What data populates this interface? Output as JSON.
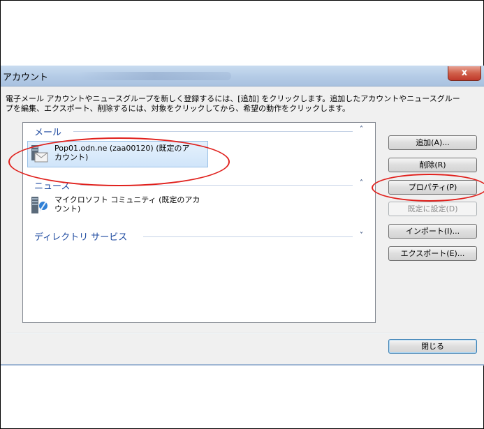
{
  "window": {
    "title": "アカウント",
    "close_label": "x"
  },
  "instruction": "電子メール アカウントやニュースグループを新しく登録するには、[追加] をクリックします。追加したアカウントやニュースグルー\nプを編集、エクスポート、削除するには、対象をクリックしてから、希望の動作をクリックします。",
  "groups": {
    "mail": {
      "label": "メール",
      "chevron": "˄",
      "items": [
        {
          "label": "Pop01.odn.ne (zaa00120) (既定のア\nカウント)",
          "icon": "mail-account-icon",
          "selected": true
        }
      ]
    },
    "news": {
      "label": "ニュース",
      "chevron": "˄",
      "items": [
        {
          "label": "マイクロソフト コミュニティ (既定のアカ\nウント)",
          "icon": "news-account-icon",
          "selected": false
        }
      ]
    },
    "directory": {
      "label": "ディレクトリ サービス",
      "chevron": "˅"
    }
  },
  "buttons": {
    "add": "追加(A)...",
    "remove": "削除(R)",
    "properties": "プロパティ(P)",
    "set_default": "既定に設定(D)",
    "import": "インポート(I)...",
    "export": "エクスポート(E)...",
    "close": "閉じる"
  },
  "colors": {
    "accent_blue": "#1e4aa0",
    "annotation_red": "#e0201c",
    "selection": "#d0e5fa"
  }
}
